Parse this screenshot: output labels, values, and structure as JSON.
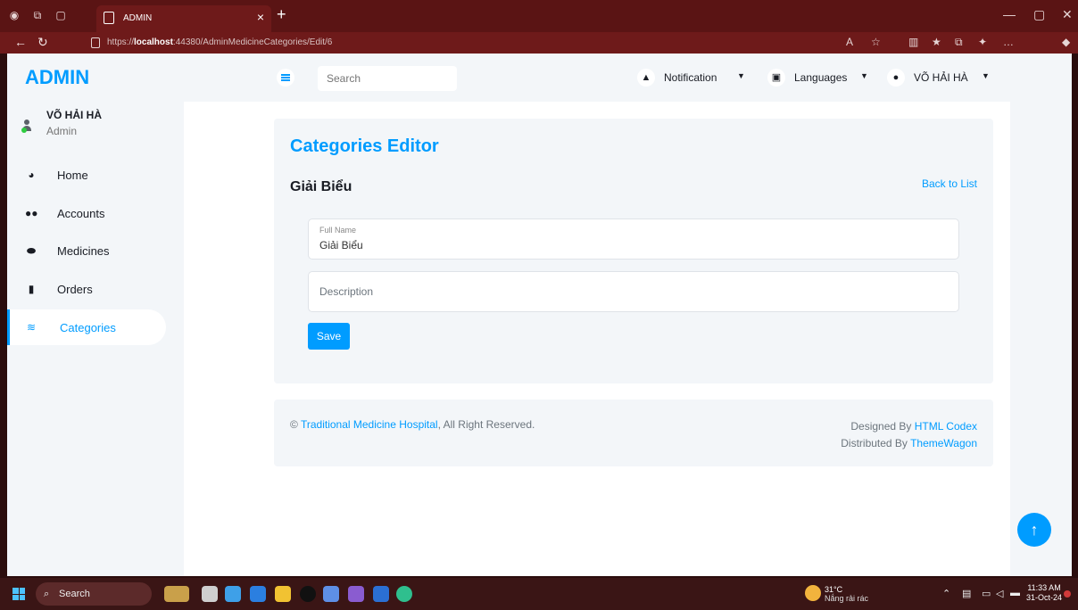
{
  "browser": {
    "tab_title": "ADMIN",
    "url_prefix": "https://",
    "url_host": "localhost",
    "url_rest": ":44380/AdminMedicineCategories/Edit/6",
    "new_tab": "+",
    "tab_close": "×"
  },
  "sidebar": {
    "brand": "ADMIN",
    "user_name": "VÕ HẢI HÀ",
    "user_role": "Admin",
    "items": [
      {
        "label": "Home",
        "icon": "tachometer-icon"
      },
      {
        "label": "Accounts",
        "icon": "users-icon"
      },
      {
        "label": "Medicines",
        "icon": "pills-icon"
      },
      {
        "label": "Orders",
        "icon": "file-icon"
      },
      {
        "label": "Categories",
        "icon": "layers-icon"
      }
    ]
  },
  "topbar": {
    "search_placeholder": "Search",
    "notification_label": "Notification",
    "languages_label": "Languages",
    "user_label": "VÕ HẢI HÀ"
  },
  "editor": {
    "title": "Categories Editor",
    "name": "Giải Biểu",
    "back_link": "Back to List",
    "full_name_label": "Full Name",
    "full_name_value": "Giải Biểu",
    "description_placeholder": "Description",
    "save_label": "Save"
  },
  "footer": {
    "copyright_symbol": "©",
    "site_name": "Traditional Medicine Hospital",
    "rights": ", All Right Reserved.",
    "designed_by": "Designed By",
    "designer": "HTML Codex",
    "distributed_by": "Distributed By",
    "distributor": "ThemeWagon"
  },
  "taskbar": {
    "search_label": "Search",
    "temperature": "31°C",
    "weather": "Nắng rải rác",
    "weather_badge": "1",
    "time": "11:33 AM",
    "date": "31-Oct-24"
  },
  "colors": {
    "primary": "#009cff",
    "browser_frame": "#5a1414",
    "sidebar_bg": "#f3f6f9"
  }
}
